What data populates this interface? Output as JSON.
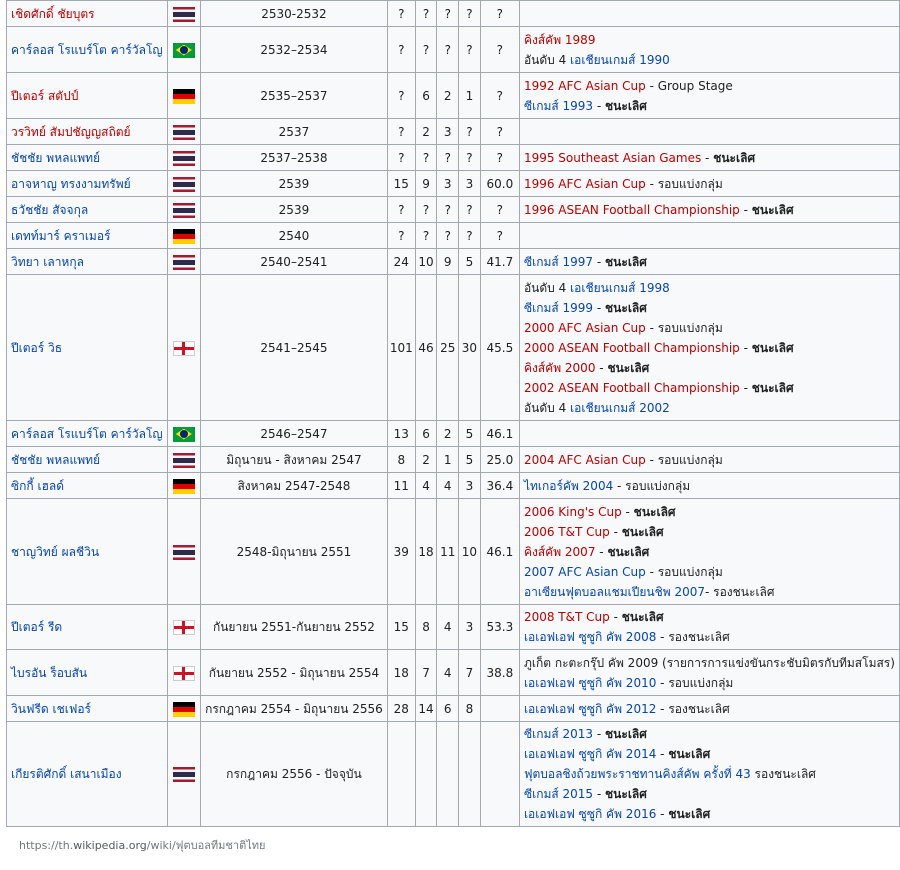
{
  "rows": [
    {
      "name": "เชิดศักดิ์ ชัยบุตร",
      "flag": "thailand-flag-icon",
      "period": "2530-2532",
      "p": "?",
      "w": "?",
      "d": "?",
      "l": "?",
      "pct": "?",
      "ach": []
    },
    {
      "name": "คาร์ลอส โรแบร์โต คาร์วัลโญ",
      "flag": "brazil-flag-icon",
      "period": "2532–2534",
      "p": "?",
      "w": "?",
      "d": "?",
      "l": "?",
      "pct": "?",
      "ach": [
        [
          {
            "t": "คิงส์คัพ 1989",
            "c": "red"
          }
        ],
        [
          {
            "t": "อันดับ 4 ",
            "c": ""
          },
          {
            "t": "เอเชียนเกมส์ 1990",
            "c": "blue"
          }
        ]
      ]
    },
    {
      "name": "ปีเตอร์ สตัปป์",
      "flag": "germany-flag-icon",
      "period": "2535–2537",
      "p": "?",
      "w": "6",
      "d": "2",
      "l": "1",
      "pct": "?",
      "ach": [
        [
          {
            "t": "1992 AFC Asian Cup",
            "c": "red"
          },
          {
            "t": " - Group Stage",
            "c": ""
          }
        ],
        [
          {
            "t": "ซีเกมส์ 1993",
            "c": "blue"
          },
          {
            "t": " - ",
            "c": ""
          },
          {
            "t": "ชนะเลิศ",
            "c": "bold"
          }
        ]
      ]
    },
    {
      "name": "วรวิทย์ สัมปชัญญสถิตย์",
      "flag": "thailand-flag-icon",
      "period": "2537",
      "p": "?",
      "w": "2",
      "d": "3",
      "l": "?",
      "pct": "?",
      "ach": []
    },
    {
      "name": "ชัชชัย พหลแพทย์",
      "flag": "thailand-flag-icon",
      "period": "2537–2538",
      "p": "?",
      "w": "?",
      "d": "?",
      "l": "?",
      "pct": "?",
      "ach": [
        [
          {
            "t": "1995 Southeast Asian Games",
            "c": "red"
          },
          {
            "t": " - ",
            "c": ""
          },
          {
            "t": "ชนะเลิศ",
            "c": "bold"
          }
        ]
      ]
    },
    {
      "name": "อาจหาญ ทรงงามทรัพย์",
      "flag": "thailand-flag-icon",
      "period": "2539",
      "p": "15",
      "w": "9",
      "d": "3",
      "l": "3",
      "pct": "60.0",
      "ach": [
        [
          {
            "t": "1996 AFC Asian Cup",
            "c": "red"
          },
          {
            "t": " - รอบแบ่งกลุ่ม",
            "c": ""
          }
        ]
      ]
    },
    {
      "name": "ธวัชชัย สัจจกุล",
      "flag": "thailand-flag-icon",
      "period": "2539",
      "p": "?",
      "w": "?",
      "d": "?",
      "l": "?",
      "pct": "?",
      "ach": [
        [
          {
            "t": "1996 ASEAN Football Championship",
            "c": "red"
          },
          {
            "t": " - ",
            "c": ""
          },
          {
            "t": "ชนะเลิศ",
            "c": "bold"
          }
        ]
      ]
    },
    {
      "name": "เดทท์มาร์ คราเมอร์",
      "flag": "germany-flag-icon",
      "period": "2540",
      "p": "?",
      "w": "?",
      "d": "?",
      "l": "?",
      "pct": "?",
      "ach": []
    },
    {
      "name": "วิทยา เลาหกุล",
      "flag": "thailand-flag-icon",
      "period": "2540–2541",
      "p": "24",
      "w": "10",
      "d": "9",
      "l": "5",
      "pct": "41.7",
      "ach": [
        [
          {
            "t": "ซีเกมส์ 1997",
            "c": "blue"
          },
          {
            "t": " - ",
            "c": ""
          },
          {
            "t": "ชนะเลิศ",
            "c": "bold"
          }
        ]
      ]
    },
    {
      "name": "ปีเตอร์ วิธ",
      "flag": "england-flag-icon",
      "period": "2541–2545",
      "p": "101",
      "w": "46",
      "d": "25",
      "l": "30",
      "pct": "45.5",
      "ach": [
        [
          {
            "t": "อันดับ 4 ",
            "c": ""
          },
          {
            "t": "เอเชียนเกมส์ 1998",
            "c": "blue"
          }
        ],
        [
          {
            "t": "ซีเกมส์ 1999",
            "c": "blue"
          },
          {
            "t": " - ",
            "c": ""
          },
          {
            "t": "ชนะเลิศ",
            "c": "bold"
          }
        ],
        [
          {
            "t": "2000 AFC Asian Cup",
            "c": "red"
          },
          {
            "t": " - รอบแบ่งกลุ่ม",
            "c": ""
          }
        ],
        [
          {
            "t": "2000 ASEAN Football Championship",
            "c": "red"
          },
          {
            "t": " - ",
            "c": ""
          },
          {
            "t": "ชนะเลิศ",
            "c": "bold"
          }
        ],
        [
          {
            "t": "คิงส์คัพ 2000",
            "c": "red"
          },
          {
            "t": " - ",
            "c": ""
          },
          {
            "t": "ชนะเลิศ",
            "c": "bold"
          }
        ],
        [
          {
            "t": "2002 ASEAN Football Championship",
            "c": "red"
          },
          {
            "t": " - ",
            "c": ""
          },
          {
            "t": "ชนะเลิศ",
            "c": "bold"
          }
        ],
        [
          {
            "t": "อันดับ 4 ",
            "c": ""
          },
          {
            "t": "เอเชียนเกมส์ 2002",
            "c": "blue"
          }
        ]
      ]
    },
    {
      "name": "คาร์ลอส โรแบร์โต คาร์วัลโญ",
      "flag": "brazil-flag-icon",
      "period": "2546–2547",
      "p": "13",
      "w": "6",
      "d": "2",
      "l": "5",
      "pct": "46.1",
      "ach": []
    },
    {
      "name": "ชัชชัย พหลแพทย์",
      "flag": "thailand-flag-icon",
      "period": "มิถุนายน - สิงหาคม 2547",
      "p": "8",
      "w": "2",
      "d": "1",
      "l": "5",
      "pct": "25.0",
      "ach": [
        [
          {
            "t": "2004 AFC Asian Cup",
            "c": "red"
          },
          {
            "t": " - รอบแบ่งกลุ่ม",
            "c": ""
          }
        ]
      ]
    },
    {
      "name": "ซิกกี้ เฮลด์",
      "flag": "germany-flag-icon",
      "period": "สิงหาคม 2547-2548",
      "p": "11",
      "w": "4",
      "d": "4",
      "l": "3",
      "pct": "36.4",
      "ach": [
        [
          {
            "t": "ไทเกอร์คัพ 2004",
            "c": "blue"
          },
          {
            "t": " - รอบแบ่งกลุ่ม",
            "c": ""
          }
        ]
      ]
    },
    {
      "name": "ชาญวิทย์ ผลชีวิน",
      "flag": "thailand-flag-icon",
      "period": "2548-มิถุนายน 2551",
      "p": "39",
      "w": "18",
      "d": "11",
      "l": "10",
      "pct": "46.1",
      "ach": [
        [
          {
            "t": "2006 King's Cup",
            "c": "red"
          },
          {
            "t": " - ",
            "c": ""
          },
          {
            "t": "ชนะเลิศ",
            "c": "bold"
          }
        ],
        [
          {
            "t": "2006 T&T Cup",
            "c": "red"
          },
          {
            "t": " - ",
            "c": ""
          },
          {
            "t": "ชนะเลิศ",
            "c": "bold"
          }
        ],
        [
          {
            "t": "คิงส์คัพ 2007",
            "c": "red"
          },
          {
            "t": " - ",
            "c": ""
          },
          {
            "t": "ชนะเลิศ",
            "c": "bold"
          }
        ],
        [
          {
            "t": "2007 AFC Asian Cup",
            "c": "blue"
          },
          {
            "t": " - รอบแบ่งกลุ่ม",
            "c": ""
          }
        ],
        [
          {
            "t": "อาเซียนฟุตบอลแชมเปียนชิพ 2007",
            "c": "blue"
          },
          {
            "t": "- รองชนะเลิศ",
            "c": ""
          }
        ]
      ]
    },
    {
      "name": "ปีเตอร์ รีด",
      "flag": "england-flag-icon",
      "period": "กันยายน 2551-กันยายน 2552",
      "p": "15",
      "w": "8",
      "d": "4",
      "l": "3",
      "pct": "53.3",
      "ach": [
        [
          {
            "t": "2008 T&T Cup",
            "c": "red"
          },
          {
            "t": " - ",
            "c": ""
          },
          {
            "t": "ชนะเลิศ",
            "c": "bold"
          }
        ],
        [
          {
            "t": "เอเอฟเอฟ ซูซูกิ คัพ 2008",
            "c": "blue"
          },
          {
            "t": " - รองชนะเลิศ",
            "c": ""
          }
        ]
      ]
    },
    {
      "name": "ไบรอัน ร็อบสัน",
      "flag": "england-flag-icon",
      "period": "กันยายน 2552 - มิถุนายน 2554",
      "p": "18",
      "w": "7",
      "d": "4",
      "l": "7",
      "pct": "38.8",
      "ach": [
        [
          {
            "t": "ภูเก็ต กะตะกรุ๊ป คัพ 2009 (รายการการแข่งขันกระชับมิตรกับทีมสโมสร)",
            "c": ""
          }
        ],
        [
          {
            "t": "เอเอฟเอฟ ซูซูกิ คัพ 2010",
            "c": "blue"
          },
          {
            "t": " - รอบแบ่งกลุ่ม",
            "c": ""
          }
        ]
      ]
    },
    {
      "name": "วินฟรีด เชเฟอร์",
      "flag": "germany-flag-icon",
      "period": "กรกฎาคม 2554 - มิถุนายน 2556",
      "p": "28",
      "w": "14",
      "d": "6",
      "l": "8",
      "pct": "",
      "ach": [
        [
          {
            "t": "เอเอฟเอฟ ซูซูกิ คัพ 2012",
            "c": "blue"
          },
          {
            "t": " - รองชนะเลิศ",
            "c": ""
          }
        ]
      ]
    },
    {
      "name": "เกียรติศักดิ์ เสนาเมือง",
      "flag": "thailand-flag-icon",
      "period": "กรกฎาคม 2556 - ปัจจุบัน",
      "p": "",
      "w": "",
      "d": "",
      "l": "",
      "pct": "",
      "ach": [
        [
          {
            "t": "ซีเกมส์ 2013",
            "c": "blue"
          },
          {
            "t": " - ",
            "c": ""
          },
          {
            "t": "ชนะเลิศ",
            "c": "bold"
          }
        ],
        [
          {
            "t": "เอเอฟเอฟ ซูซูกิ คัพ 2014",
            "c": "blue"
          },
          {
            "t": " - ",
            "c": ""
          },
          {
            "t": "ชนะเลิศ",
            "c": "bold"
          }
        ],
        [
          {
            "t": "ฟุตบอลชิงถ้วยพระราชทานคิงส์คัพ ครั้งที่ 43",
            "c": "blue"
          },
          {
            "t": " รองชนะเลิศ",
            "c": ""
          }
        ],
        [
          {
            "t": "ซีเกมส์ 2015",
            "c": "blue"
          },
          {
            "t": " - ",
            "c": ""
          },
          {
            "t": "ชนะเลิศ",
            "c": "bold"
          }
        ],
        [
          {
            "t": " เอเอฟเอฟ ซูซูกิ คัพ 2016",
            "c": "blue"
          },
          {
            "t": " - ",
            "c": ""
          },
          {
            "t": "ชนะเลิศ",
            "c": "bold"
          }
        ]
      ]
    }
  ],
  "footer": {
    "prefix": "https://th.",
    "domain": "wikipedia.org",
    "suffix": "/wiki/ฟุตบอลทีมชาติไทย"
  }
}
